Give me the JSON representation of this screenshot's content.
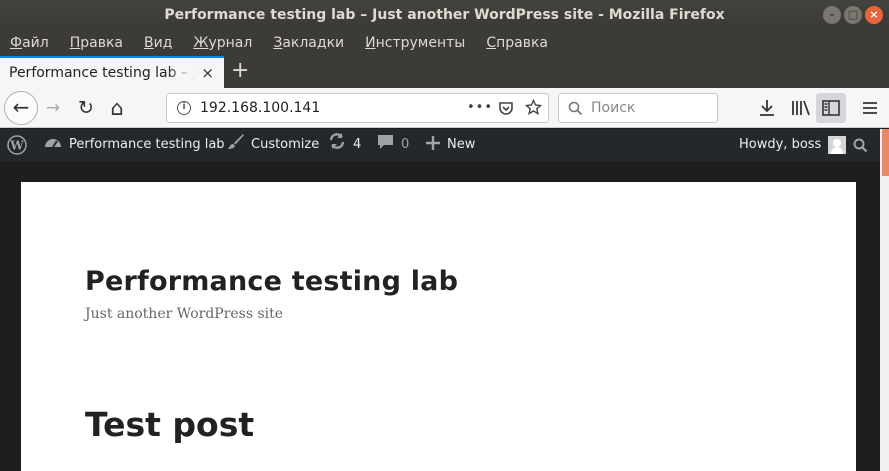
{
  "window": {
    "title": "Performance testing lab – Just another WordPress site - Mozilla Firefox",
    "buttons": {
      "minimize": "–",
      "maximize": "□",
      "close": "×"
    }
  },
  "menu": {
    "items": [
      "Файл",
      "Правка",
      "Вид",
      "Журнал",
      "Закладки",
      "Инструменты",
      "Справка"
    ]
  },
  "tab": {
    "label": "Performance testing lab – Just another WordPress site",
    "close": "×",
    "new_tab": "+"
  },
  "navbar": {
    "back": "←",
    "forward": "→",
    "reload": "↻",
    "home": "⌂",
    "url": "192.168.100.141",
    "page_actions": "•••",
    "search_placeholder": "Поиск",
    "icons": [
      "info-icon",
      "pocket-icon",
      "bookmark-star-icon",
      "download-icon",
      "library-icon",
      "sidebar-icon",
      "hamburger-menu-icon"
    ],
    "accent": "#0a84ff"
  },
  "adminbar": {
    "site_name": "Performance testing lab",
    "customize": "Customize",
    "updates_count": "4",
    "comments_count": "0",
    "new": "New",
    "howdy": "Howdy, boss",
    "background": "#23282d"
  },
  "page": {
    "site_title": "Performance testing lab",
    "site_description": "Just another WordPress site",
    "post_title": "Test post"
  }
}
